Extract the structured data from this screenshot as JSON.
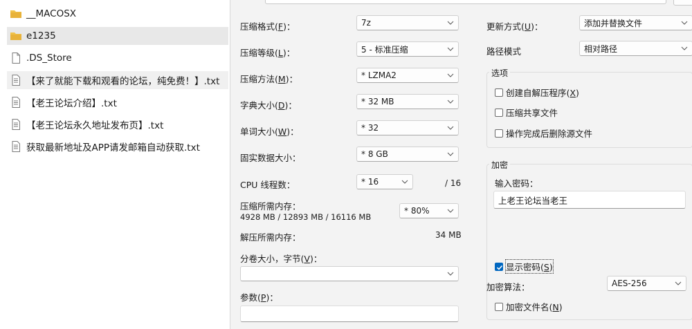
{
  "files": [
    {
      "name": "__MACOSX",
      "icon": "folder-icon"
    },
    {
      "name": "e1235",
      "icon": "folder-icon"
    },
    {
      "name": ".DS_Store",
      "icon": "file-icon"
    },
    {
      "name": "【来了就能下载和观看的论坛，纯免费！】.txt",
      "icon": "text-file-icon"
    },
    {
      "name": "【老王论坛介绍】.txt",
      "icon": "text-file-icon"
    },
    {
      "name": "【老王论坛永久地址发布页】.txt",
      "icon": "text-file-icon"
    },
    {
      "name": "获取最新地址及APP请发邮箱自动获取.txt",
      "icon": "text-file-icon"
    }
  ],
  "dialog": {
    "format": {
      "label": "压缩格式",
      "key": "F",
      "value": "7z"
    },
    "level": {
      "label": "压缩等级",
      "key": "L",
      "value": "5 - 标准压缩"
    },
    "method": {
      "label": "压缩方法",
      "key": "M",
      "value": "* LZMA2"
    },
    "dict": {
      "label": "字典大小",
      "key": "D",
      "value": "* 32 MB"
    },
    "word": {
      "label": "单词大小",
      "key": "W",
      "value": "* 32"
    },
    "solid": {
      "label": "固实数据大小：",
      "value": "* 8 GB"
    },
    "cpu": {
      "label": "CPU 线程数：",
      "value": "* 16",
      "total": "/ 16"
    },
    "mem_compress": {
      "label": "压缩所需内存：",
      "detail": "4928 MB / 12893 MB / 16116 MB",
      "value": "* 80%"
    },
    "mem_decompress": {
      "label": "解压所需内存：",
      "value": "34 MB"
    },
    "volume": {
      "label": "分卷大小，字节",
      "key": "V",
      "value": ""
    },
    "params": {
      "label": "参数",
      "key": "P",
      "value": ""
    },
    "update": {
      "label": "更新方式",
      "key": "U",
      "value": "添加并替换文件"
    },
    "path": {
      "label": "路径模式",
      "value": "相对路径"
    },
    "options": {
      "title": "选项",
      "sfx": {
        "label": "创建自解压程序",
        "key": "X",
        "checked": false
      },
      "shared": {
        "label": "压缩共享文件",
        "checked": false
      },
      "delete": {
        "label": "操作完成后删除源文件",
        "checked": false
      }
    },
    "encryption": {
      "title": "加密",
      "password_label": "输入密码：",
      "password": "上老王论坛当老王",
      "show": {
        "label": "显示密码",
        "key": "S",
        "checked": true
      },
      "method_label": "加密算法：",
      "method_value": "AES-256",
      "names": {
        "label": "加密文件名",
        "key": "N",
        "checked": false
      }
    }
  },
  "colors": {
    "accent": "#0067c0",
    "folder": "#e8b23a",
    "dialog_bg": "#f3f3f3"
  }
}
